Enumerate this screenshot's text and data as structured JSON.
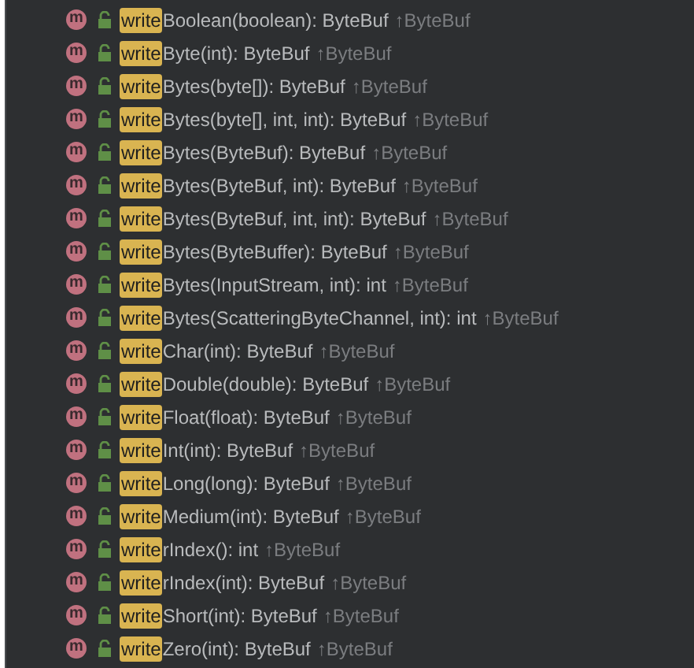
{
  "completion_items": [
    {
      "icon": "m",
      "match": "write",
      "signature": "Boolean(boolean): ByteBuf",
      "owner": "↑ByteBuf"
    },
    {
      "icon": "m",
      "match": "write",
      "signature": "Byte(int): ByteBuf",
      "owner": "↑ByteBuf"
    },
    {
      "icon": "m",
      "match": "write",
      "signature": "Bytes(byte[]): ByteBuf",
      "owner": "↑ByteBuf"
    },
    {
      "icon": "m",
      "match": "write",
      "signature": "Bytes(byte[], int, int): ByteBuf",
      "owner": "↑ByteBuf"
    },
    {
      "icon": "m",
      "match": "write",
      "signature": "Bytes(ByteBuf): ByteBuf",
      "owner": "↑ByteBuf"
    },
    {
      "icon": "m",
      "match": "write",
      "signature": "Bytes(ByteBuf, int): ByteBuf",
      "owner": "↑ByteBuf"
    },
    {
      "icon": "m",
      "match": "write",
      "signature": "Bytes(ByteBuf, int, int): ByteBuf",
      "owner": "↑ByteBuf"
    },
    {
      "icon": "m",
      "match": "write",
      "signature": "Bytes(ByteBuffer): ByteBuf",
      "owner": "↑ByteBuf"
    },
    {
      "icon": "m",
      "match": "write",
      "signature": "Bytes(InputStream, int): int",
      "owner": "↑ByteBuf"
    },
    {
      "icon": "m",
      "match": "write",
      "signature": "Bytes(ScatteringByteChannel, int): int",
      "owner": "↑ByteBuf"
    },
    {
      "icon": "m",
      "match": "write",
      "signature": "Char(int): ByteBuf",
      "owner": "↑ByteBuf"
    },
    {
      "icon": "m",
      "match": "write",
      "signature": "Double(double): ByteBuf",
      "owner": "↑ByteBuf"
    },
    {
      "icon": "m",
      "match": "write",
      "signature": "Float(float): ByteBuf",
      "owner": "↑ByteBuf"
    },
    {
      "icon": "m",
      "match": "write",
      "signature": "Int(int): ByteBuf",
      "owner": "↑ByteBuf"
    },
    {
      "icon": "m",
      "match": "write",
      "signature": "Long(long): ByteBuf",
      "owner": "↑ByteBuf"
    },
    {
      "icon": "m",
      "match": "write",
      "signature": "Medium(int): ByteBuf",
      "owner": "↑ByteBuf"
    },
    {
      "icon": "m",
      "match": "write",
      "signature": "rIndex(): int",
      "owner": "↑ByteBuf"
    },
    {
      "icon": "m",
      "match": "write",
      "signature": "rIndex(int): ByteBuf",
      "owner": "↑ByteBuf"
    },
    {
      "icon": "m",
      "match": "write",
      "signature": "Short(int): ByteBuf",
      "owner": "↑ByteBuf"
    },
    {
      "icon": "m",
      "match": "write",
      "signature": "Zero(int): ByteBuf",
      "owner": "↑ByteBuf"
    }
  ]
}
